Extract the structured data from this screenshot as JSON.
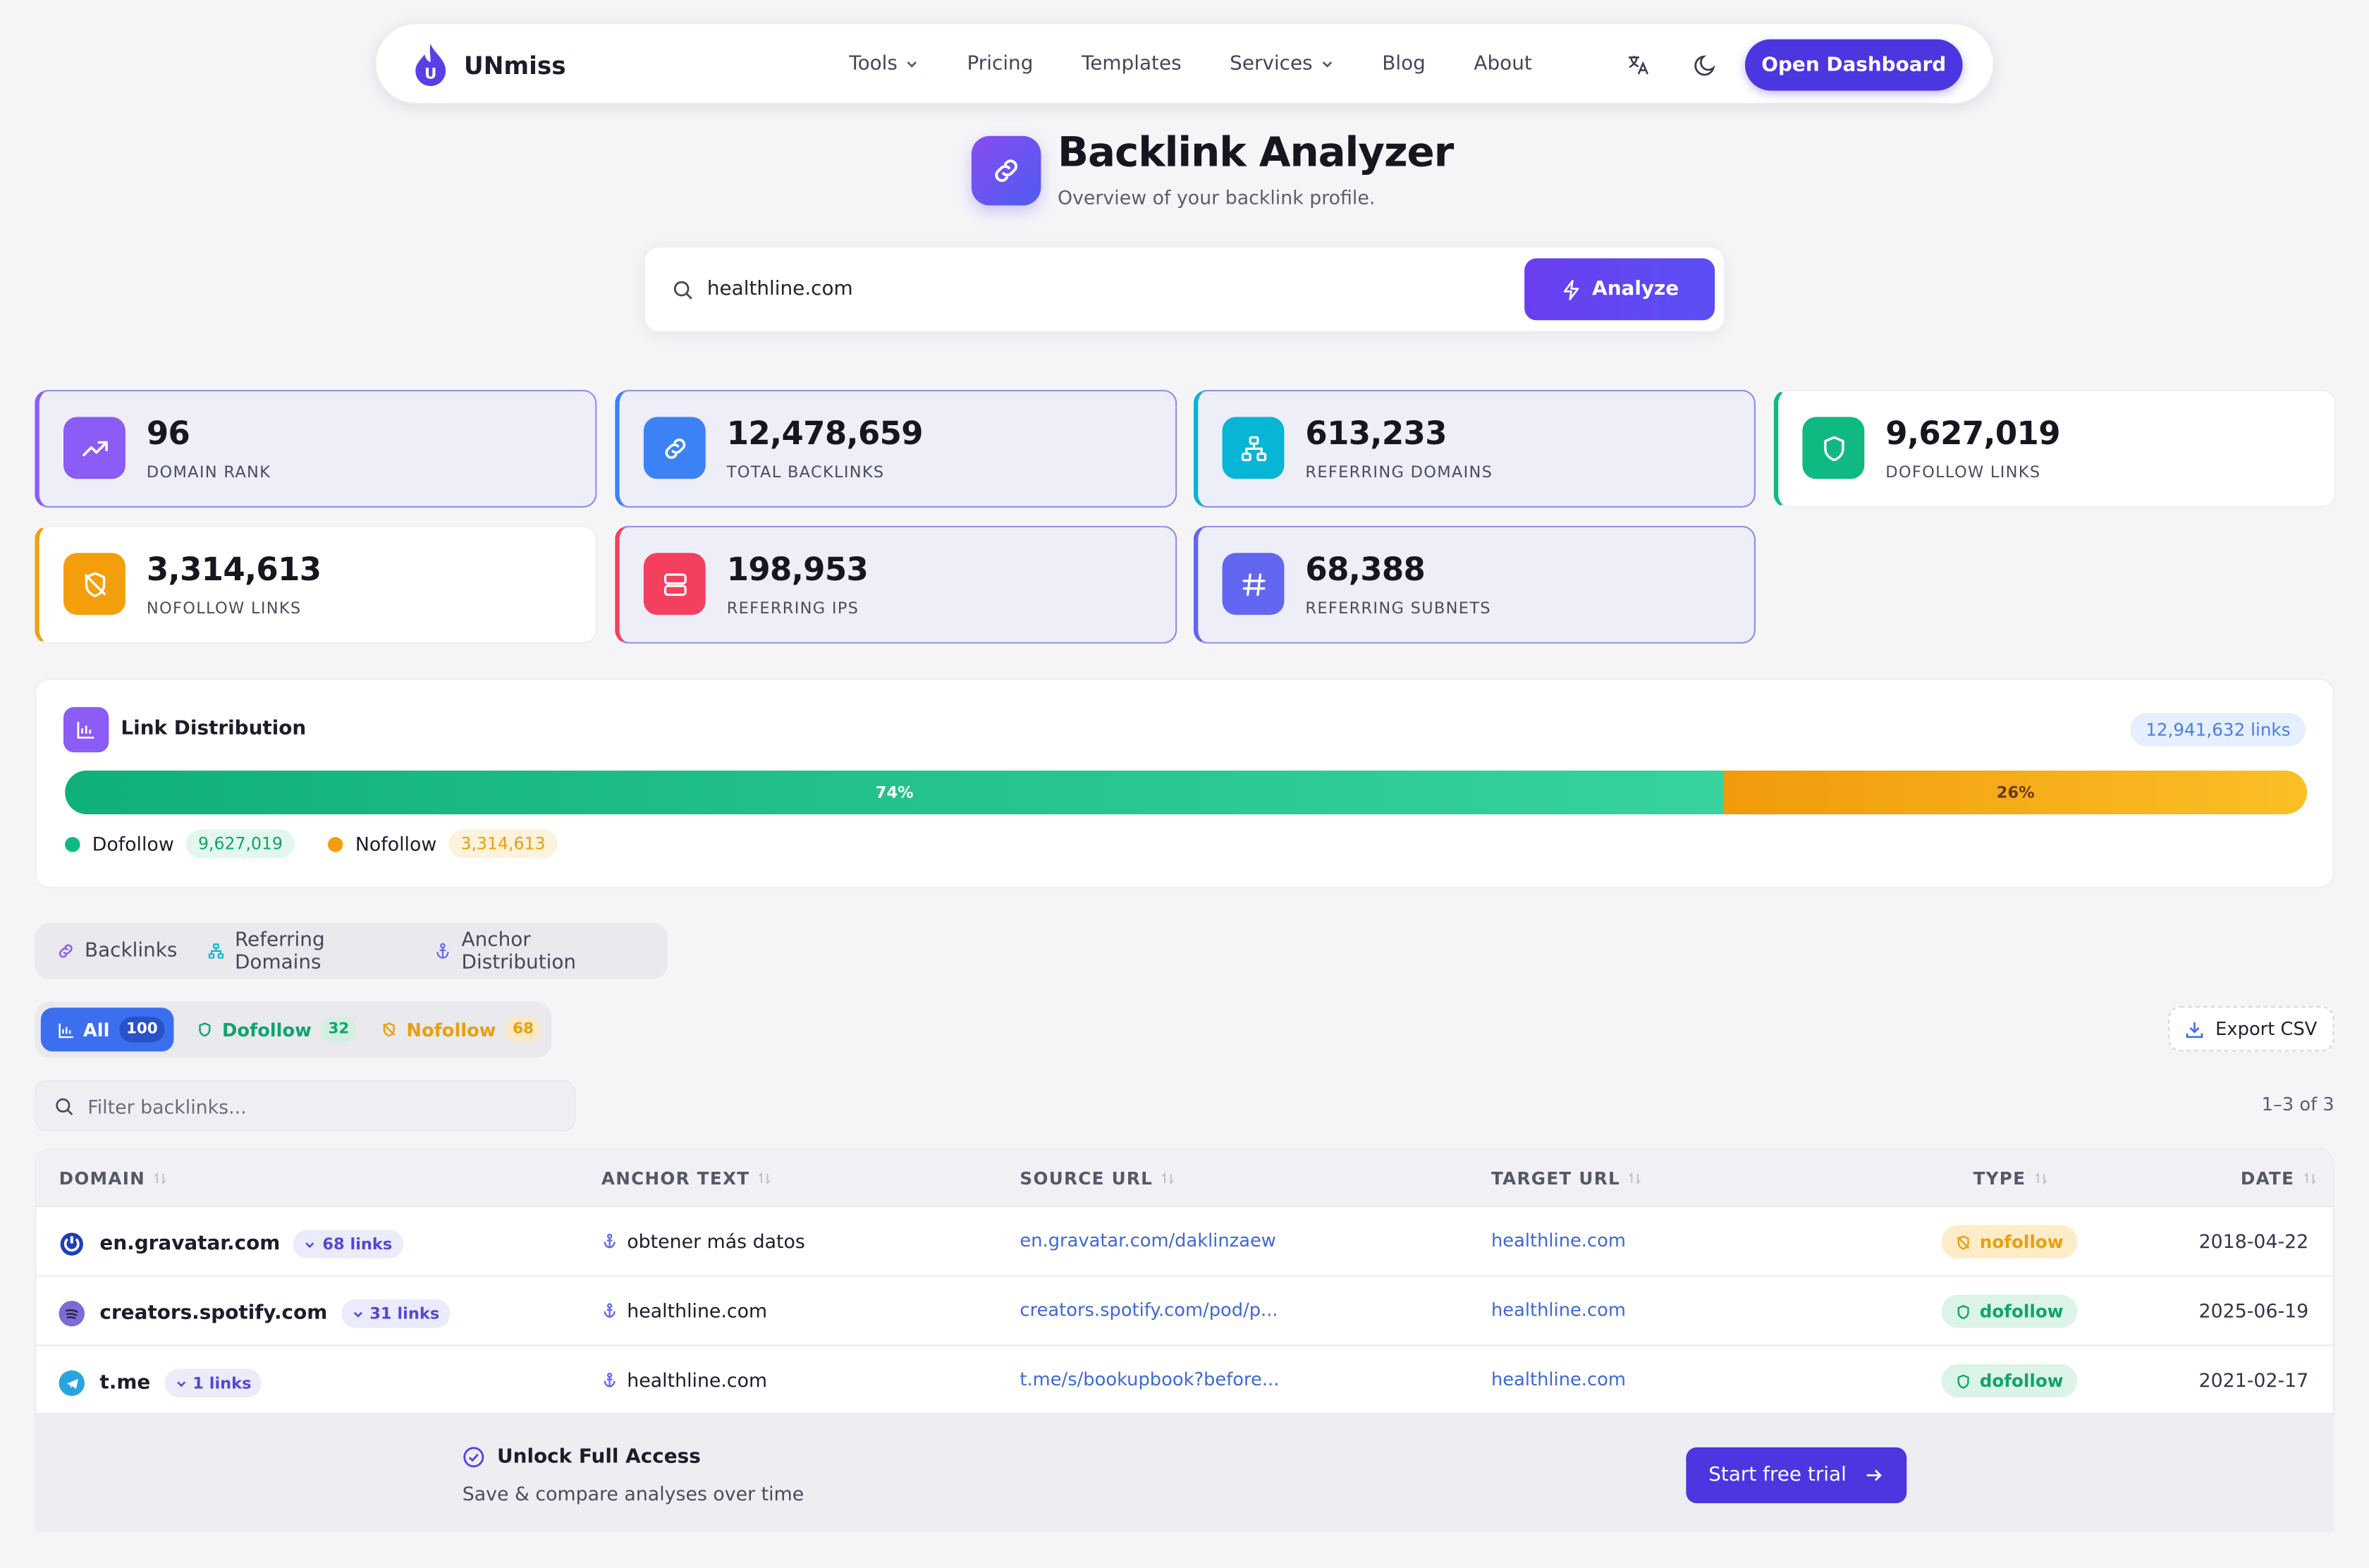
{
  "brand": {
    "name": "UNmiss",
    "mark_letter": "U"
  },
  "nav": {
    "items": [
      {
        "label": "Tools",
        "has_dropdown": true
      },
      {
        "label": "Pricing",
        "has_dropdown": false
      },
      {
        "label": "Templates",
        "has_dropdown": false
      },
      {
        "label": "Services",
        "has_dropdown": true
      },
      {
        "label": "Blog",
        "has_dropdown": false
      },
      {
        "label": "About",
        "has_dropdown": false
      }
    ],
    "cta": "Open Dashboard",
    "icons": [
      "translate-icon",
      "moon-icon"
    ]
  },
  "hero": {
    "title": "Backlink Analyzer",
    "subtitle": "Overview of your backlink profile."
  },
  "search": {
    "value": "healthline.com",
    "button": "Analyze"
  },
  "stats": [
    {
      "value": "96",
      "label": "DOMAIN RANK",
      "icon": "trending-up-icon",
      "color": "#8b5cf6"
    },
    {
      "value": "12,478,659",
      "label": "TOTAL BACKLINKS",
      "icon": "link-icon",
      "color": "#3b82f6"
    },
    {
      "value": "613,233",
      "label": "REFERRING DOMAINS",
      "icon": "network-icon",
      "color": "#06b6d4"
    },
    {
      "value": "9,627,019",
      "label": "DOFOLLOW LINKS",
      "icon": "shield-icon",
      "color": "#10b981"
    },
    {
      "value": "3,314,613",
      "label": "NOFOLLOW LINKS",
      "icon": "shield-off-icon",
      "color": "#f59e0b"
    },
    {
      "value": "198,953",
      "label": "REFERRING IPS",
      "icon": "server-icon",
      "color": "#f43f5e"
    },
    {
      "value": "68,388",
      "label": "REFERRING SUBNETS",
      "icon": "hash-icon",
      "color": "#6366f1"
    }
  ],
  "distribution": {
    "title": "Link Distribution",
    "total": "12,941,632 links",
    "dofollow_pct": 74,
    "nofollow_pct": 26,
    "dofollow_text": "74%",
    "nofollow_text": "26%",
    "dofollow_label": "Dofollow",
    "dofollow_count": "9,627,019",
    "nofollow_label": "Nofollow",
    "nofollow_count": "3,314,613"
  },
  "tabs": [
    "Backlinks",
    "Referring Domains",
    "Anchor Distribution"
  ],
  "filters": [
    {
      "label": "All",
      "count": "100",
      "active": true
    },
    {
      "label": "Dofollow",
      "count": "32",
      "active": false
    },
    {
      "label": "Nofollow",
      "count": "68",
      "active": false
    }
  ],
  "export_label": "Export CSV",
  "filter_placeholder": "Filter backlinks...",
  "pager": "1–3 of 3",
  "table": {
    "columns": [
      "DOMAIN",
      "ANCHOR TEXT",
      "SOURCE URL",
      "TARGET URL",
      "TYPE",
      "DATE"
    ],
    "rows": [
      {
        "domain": "en.gravatar.com",
        "links": "68 links",
        "anchor": "obtener más datos",
        "source": "en.gravatar.com/daklinzaew",
        "target": "healthline.com",
        "type": "nofollow",
        "date": "2018-04-22"
      },
      {
        "domain": "creators.spotify.com",
        "links": "31 links",
        "anchor": "healthline.com",
        "source": "creators.spotify.com/pod/p...",
        "target": "healthline.com",
        "type": "dofollow",
        "date": "2025-06-19"
      },
      {
        "domain": "t.me",
        "links": "1 links",
        "anchor": "healthline.com",
        "source": "t.me/s/bookupbook?before...",
        "target": "healthline.com",
        "type": "dofollow",
        "date": "2021-02-17"
      }
    ]
  },
  "unlock": {
    "title": "Unlock Full Access",
    "subtitle": "Save & compare analyses over time",
    "button": "Start free trial"
  }
}
